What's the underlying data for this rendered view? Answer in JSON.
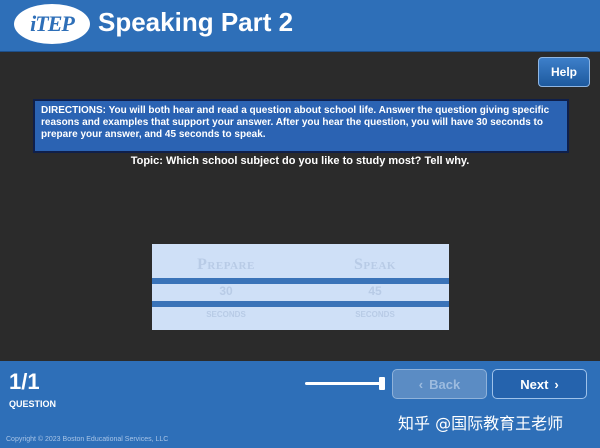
{
  "header": {
    "logo_text": "iTEP",
    "title": "Speaking Part 2",
    "color": "#2e6fb8"
  },
  "help": {
    "label": "Help"
  },
  "directions": {
    "text": "DIRECTIONS:  You will both hear and read a question about school life. Answer the question giving specific reasons and examples that support your answer. After you hear the question, you will have 30 seconds to prepare your answer, and 45 seconds to speak."
  },
  "topic": {
    "text": "Topic:  Which school subject do you like to study most? Tell why."
  },
  "timer": {
    "prepare_label": "Prepare",
    "speak_label": "Speak",
    "prepare_value": "30",
    "speak_value": "45",
    "prepare_unit": "SECONDS",
    "speak_unit": "SECONDS"
  },
  "footer": {
    "question_count": "1/1",
    "question_label": "QUESTION",
    "back_label": "Back",
    "next_label": "Next",
    "copyright": "Copyright © 2023 Boston Educational Services, LLC",
    "watermark": "知乎 @国际教育王老师",
    "volume_level": 1.0
  }
}
